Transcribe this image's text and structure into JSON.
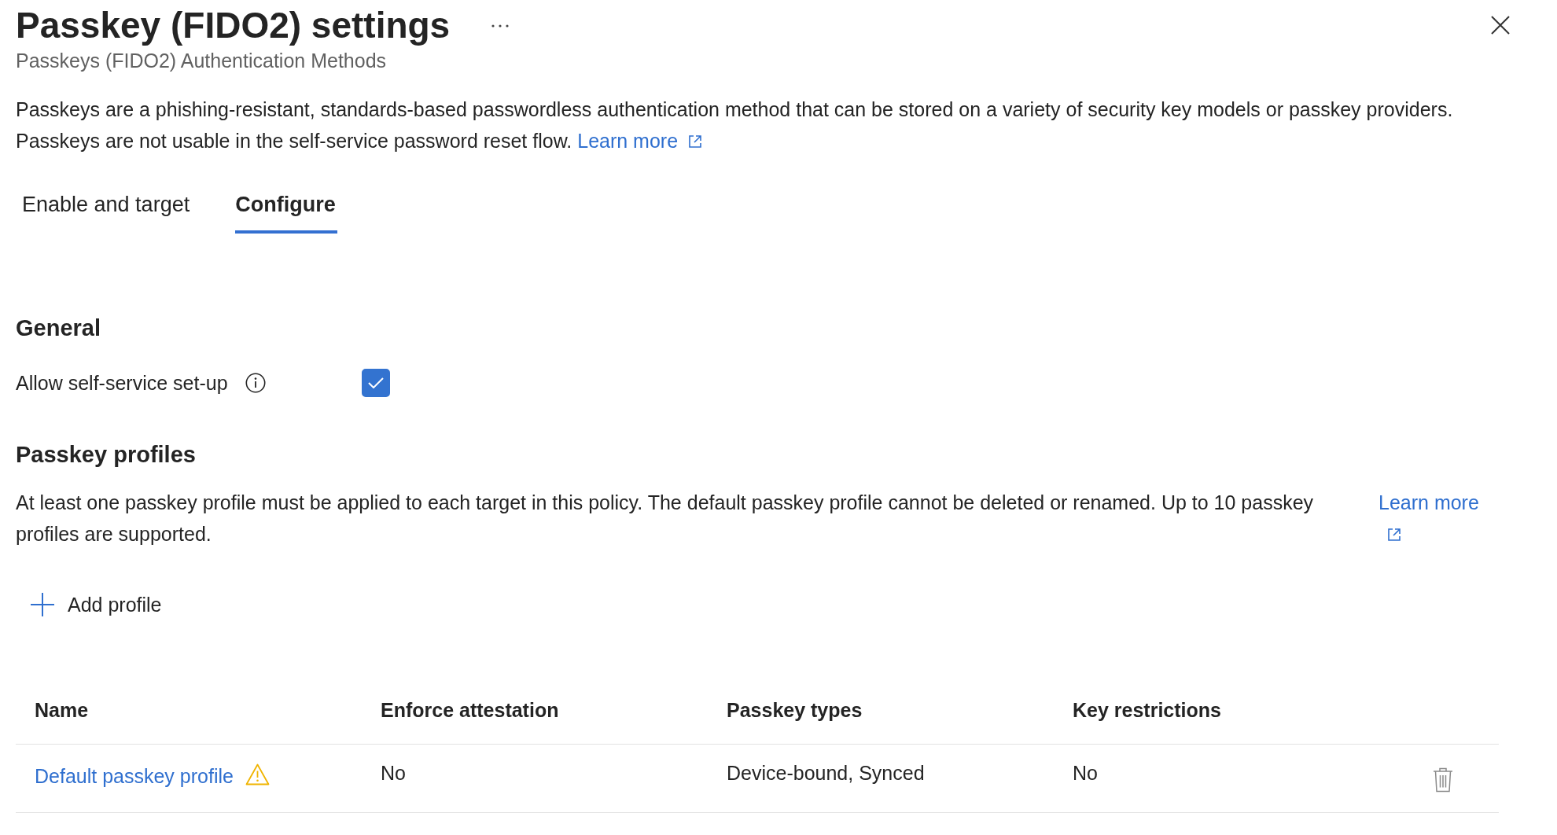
{
  "header": {
    "title": "Passkey (FIDO2) settings",
    "subtitle": "Passkeys (FIDO2) Authentication Methods"
  },
  "description": {
    "lines": [
      "Passkeys are a phishing-resistant, standards-based passwordless authentication method that can be stored on a variety of security key models or passkey providers.",
      "Passkeys are not usable in the self-service password reset flow."
    ],
    "link": "Learn more"
  },
  "tabs": [
    {
      "label": "Enable and target",
      "selected": false
    },
    {
      "label": "Configure",
      "selected": true
    }
  ],
  "general": {
    "heading": "General",
    "settings": [
      {
        "kind": "checkbox",
        "label": "Allow self-service set-up",
        "info": true,
        "checked": true
      }
    ]
  },
  "passkey_profiles": {
    "heading": "Passkey profiles",
    "text": "At least one passkey profile must be applied to each target in this policy. The default passkey profile cannot be deleted or renamed. Up to 10 passkey profiles are supported.",
    "link": "Learn more",
    "add_button": "Add profile"
  },
  "table": {
    "columns": [
      "Name",
      "Enforce attestation",
      "Passkey types",
      "Key restrictions"
    ],
    "rows": [
      {
        "name": "Default passkey profile",
        "warning": true,
        "enforce_attestation": "No",
        "passkey_types": "Device-bound, Synced",
        "key_restrictions": "No"
      }
    ]
  }
}
